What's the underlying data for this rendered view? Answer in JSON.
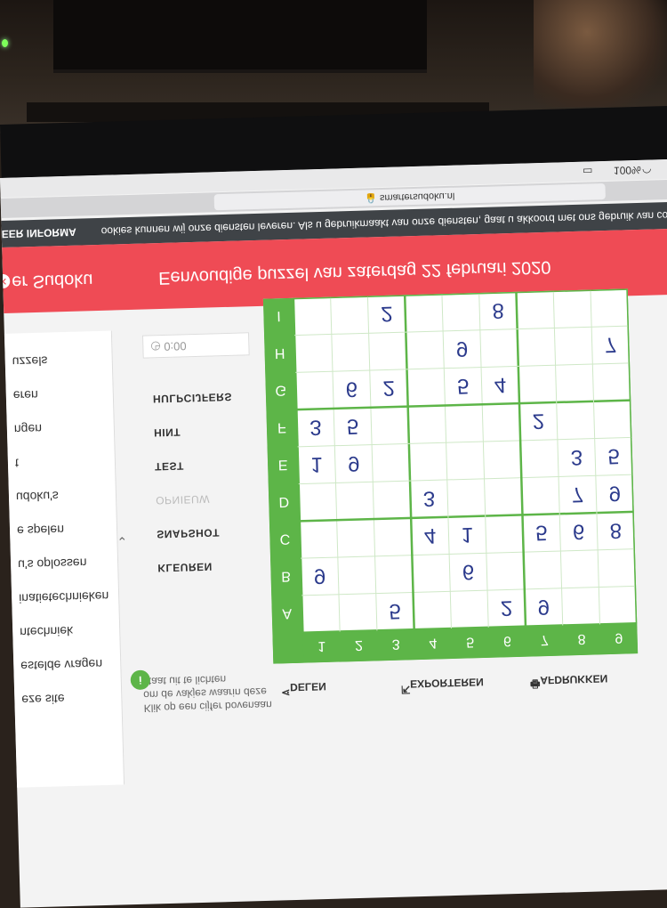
{
  "browser": {
    "battery": "100%",
    "url": "smartersudoku.nl"
  },
  "cookie": {
    "text": "ookies kunnen wij onze diensten leveren. Als u gebruikmaakt van onze diensten, gaat u akkoord met ons gebruik van cookies.",
    "more": "MEER INFORMA"
  },
  "header": {
    "logo": "er Sudoku",
    "title": "Eenvoudige puzzel van zaterdag 22 februari 2020"
  },
  "sidebar": {
    "items": [
      "uzzels",
      "eren",
      "ngen",
      "t",
      "udoku's",
      "e spelen",
      "u's oplossen",
      "inatietechnieken",
      "ntechniek",
      "estelde vragen",
      "eze site"
    ]
  },
  "tools": {
    "timer": "0:00",
    "buttons": [
      "HULPCIJFERS",
      "HINT",
      "TEST",
      "OPNIEUW",
      "SNAPSHOT",
      "KLEUREN"
    ],
    "hint_text": "Klik op een cijfer bovenaan om de vakjes waarin deze staat uit te lichten"
  },
  "actions": {
    "print": "AFDRUKKEN",
    "export": "EXPORTEREN",
    "share": "DELEN"
  },
  "board": {
    "col_labels": [
      "1",
      "2",
      "3",
      "4",
      "5",
      "6",
      "7",
      "8",
      "9"
    ],
    "row_labels": [
      "A",
      "B",
      "C",
      "D",
      "E",
      "F",
      "G",
      "H",
      "I"
    ],
    "grid": [
      [
        "",
        "",
        "5",
        "",
        "",
        "2",
        "9",
        "",
        ""
      ],
      [
        "9",
        "",
        "",
        "",
        "6",
        "",
        "",
        "",
        ""
      ],
      [
        "",
        "",
        "",
        "4",
        "1",
        "",
        "5",
        "6",
        "8"
      ],
      [
        "",
        "",
        "",
        "3",
        "",
        "",
        "",
        "7",
        "9"
      ],
      [
        "1",
        "9",
        "",
        "",
        "",
        "",
        "",
        "3",
        "5"
      ],
      [
        "3",
        "5",
        "",
        "",
        "",
        "",
        "2",
        "",
        ""
      ],
      [
        "",
        "6",
        "2",
        "",
        "5",
        "4",
        "",
        "",
        ""
      ],
      [
        "",
        "",
        "",
        "",
        "9",
        "",
        "",
        "",
        "7"
      ],
      [
        "",
        "",
        "2",
        "",
        "",
        "8",
        "",
        "",
        ""
      ]
    ],
    "colors": {
      "header": "#5db548",
      "border": "#5db548",
      "digit": "#2b3a8c"
    }
  }
}
